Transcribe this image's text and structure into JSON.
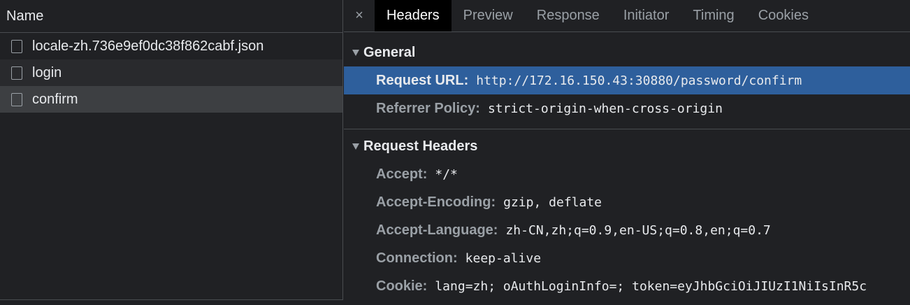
{
  "requests_pane": {
    "column_header": "Name",
    "rows": [
      {
        "name": "locale-zh.736e9ef0dc38f862cabf.json"
      },
      {
        "name": "login"
      },
      {
        "name": "confirm"
      }
    ]
  },
  "details_pane": {
    "close_glyph": "×",
    "tabs": [
      {
        "label": "Headers"
      },
      {
        "label": "Preview"
      },
      {
        "label": "Response"
      },
      {
        "label": "Initiator"
      },
      {
        "label": "Timing"
      },
      {
        "label": "Cookies"
      }
    ],
    "active_tab": "Headers",
    "general": {
      "title": "General",
      "rows": [
        {
          "key": "Request URL:",
          "value": "http://172.16.150.43:30880/password/confirm"
        },
        {
          "key": "Referrer Policy:",
          "value": "strict-origin-when-cross-origin"
        }
      ]
    },
    "request_headers": {
      "title": "Request Headers",
      "rows": [
        {
          "key": "Accept:",
          "value": "*/*"
        },
        {
          "key": "Accept-Encoding:",
          "value": "gzip, deflate"
        },
        {
          "key": "Accept-Language:",
          "value": "zh-CN,zh;q=0.9,en-US;q=0.8,en;q=0.7"
        },
        {
          "key": "Connection:",
          "value": "keep-alive"
        },
        {
          "key": "Cookie:",
          "value": "lang=zh; oAuthLoginInfo=; token=eyJhbGciOiJIUzI1NiIsInR5c"
        }
      ]
    }
  },
  "colors": {
    "background": "#202124",
    "selection_blue": "#2e5f9c",
    "selected_row": "#3d3f42",
    "active_tab_bg": "#000000"
  }
}
